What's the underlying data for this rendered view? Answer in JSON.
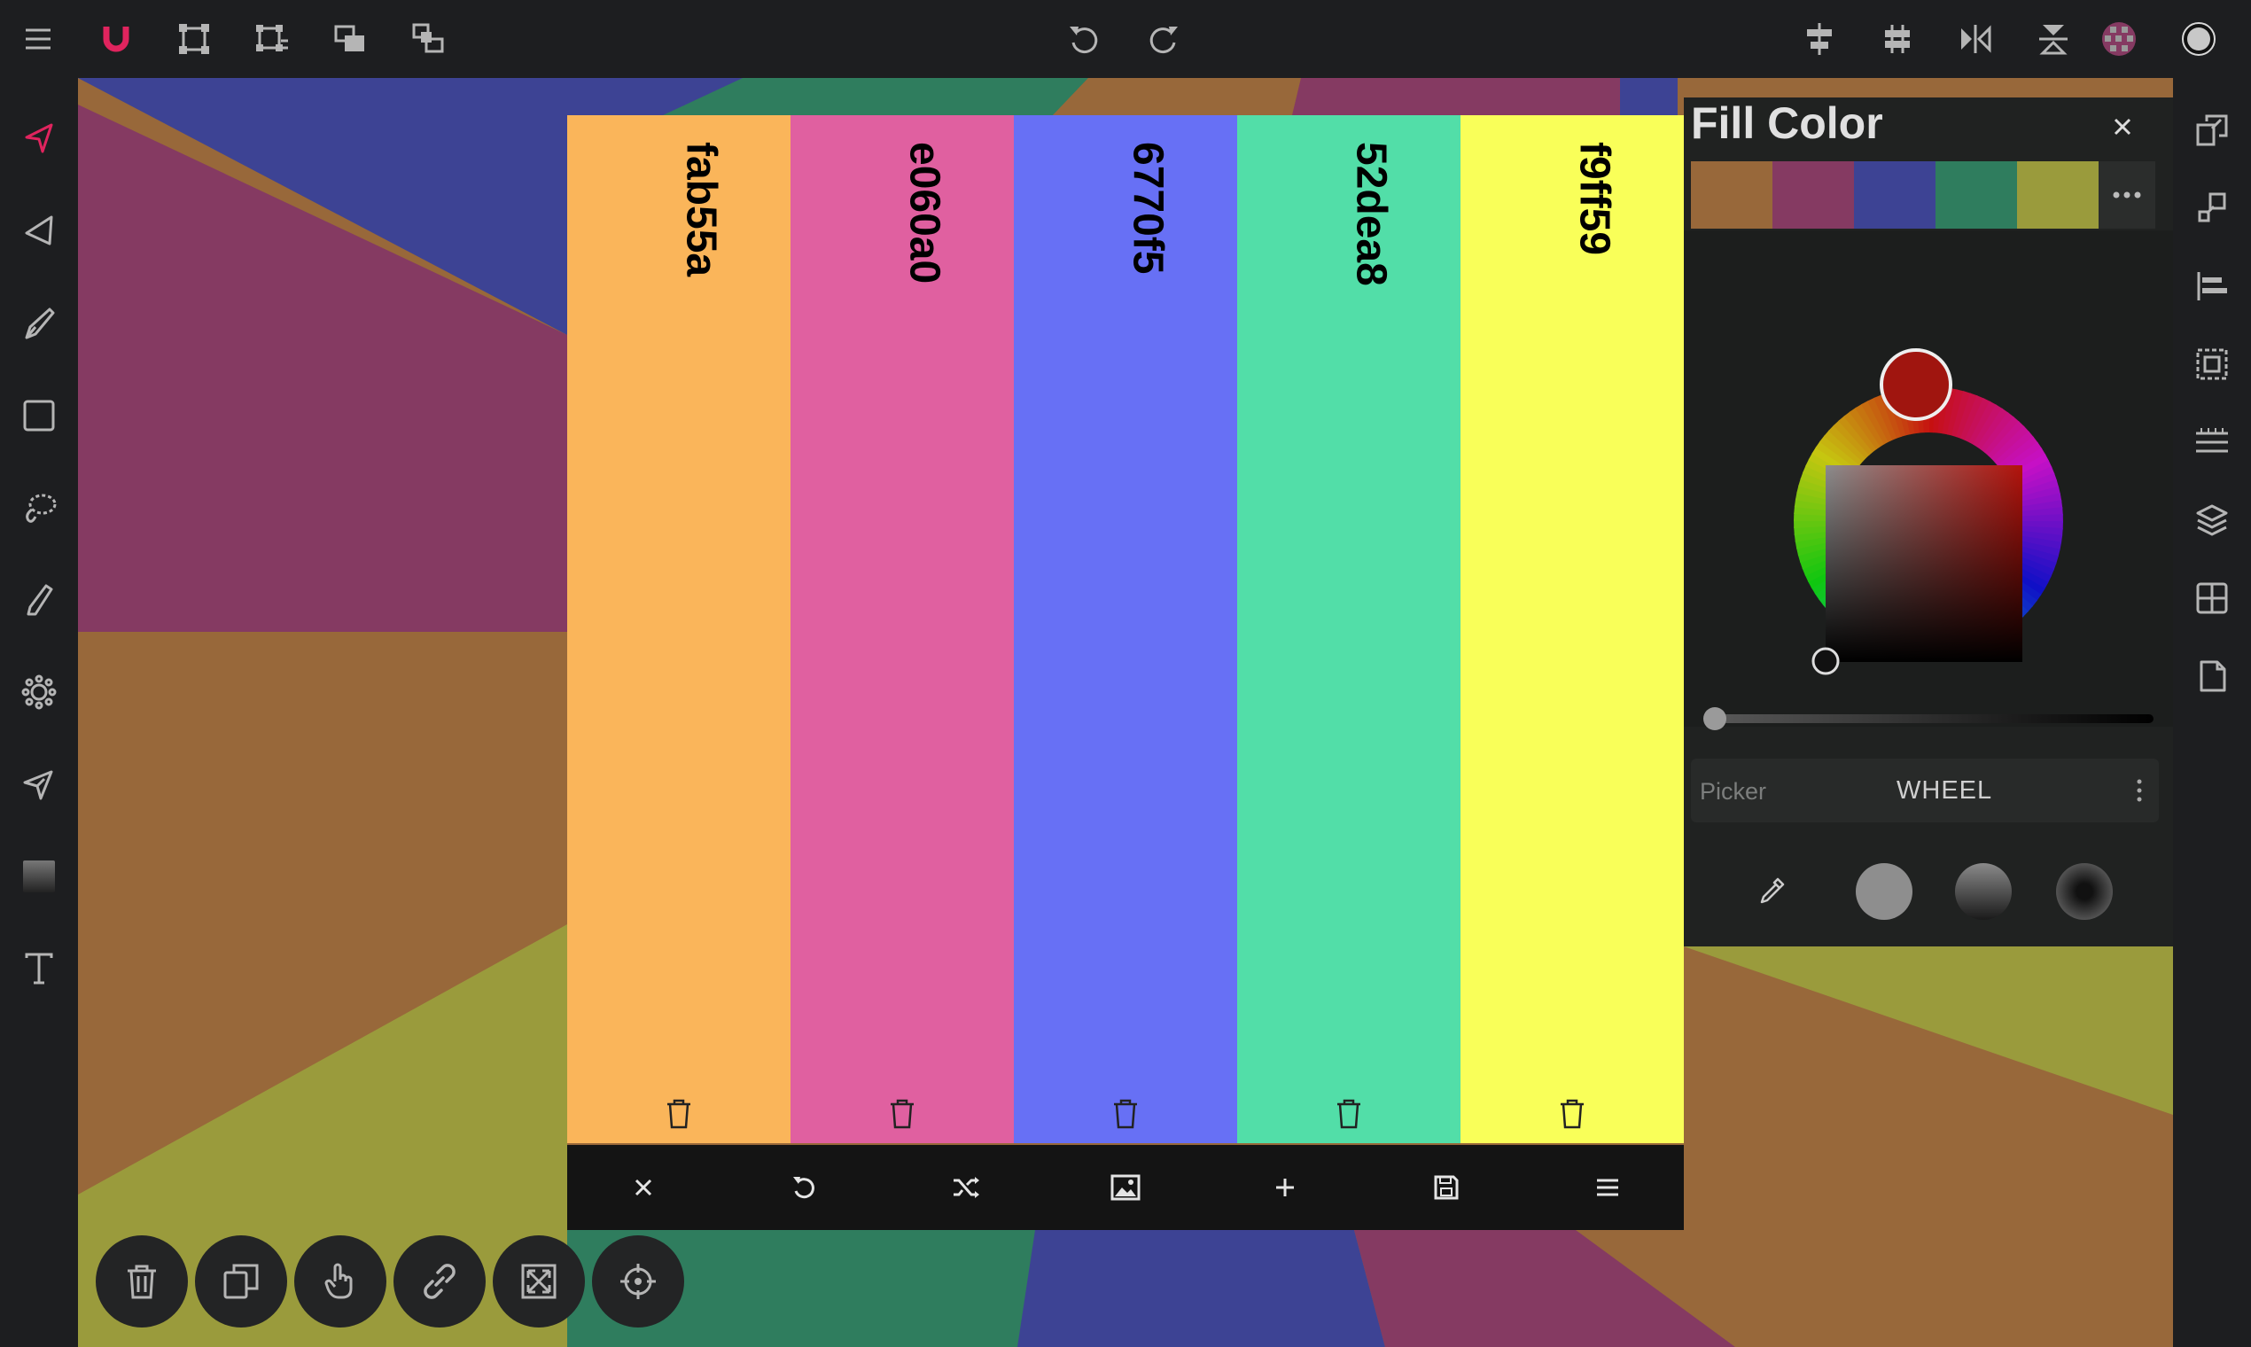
{
  "colors": {
    "bar_bg": "#1d1e20",
    "icon": "#b5b5b5",
    "accent": "#e0245e",
    "canvas_bg": [
      "#3d4394",
      "#853a62",
      "#98683a",
      "#9a9b3c",
      "#2f7d5e"
    ]
  },
  "top_toolbar": {
    "left_icons": [
      "menu-icon",
      "magnet-icon",
      "transform-icon",
      "resize-icon",
      "arrange-icon",
      "group-icon"
    ],
    "center_icons": [
      "undo-icon",
      "redo-icon"
    ],
    "right_icons": [
      "align-center-icon",
      "distribute-icon",
      "flip-horizontal-icon",
      "flip-vertical-icon",
      "fill-swatch",
      "stroke-swatch"
    ]
  },
  "left_tools": [
    "select-icon",
    "node-icon",
    "pen-icon",
    "rectangle-icon",
    "lasso-icon",
    "pencil-icon",
    "gear-icon",
    "path-icon",
    "gradient-icon",
    "text-icon"
  ],
  "right_tools": [
    "copy-style-icon",
    "shapes-icon",
    "align-icon",
    "frame-icon",
    "grid-lines-icon",
    "layers-icon",
    "table-icon",
    "page-icon"
  ],
  "palette": {
    "swatches": [
      {
        "hex": "fab55a",
        "color": "#fab55a"
      },
      {
        "hex": "e060a0",
        "color": "#e060a0"
      },
      {
        "hex": "6770f5",
        "color": "#6770f5"
      },
      {
        "hex": "52dea8",
        "color": "#52dea8"
      },
      {
        "hex": "f9ff59",
        "color": "#f9ff59"
      }
    ],
    "toolbar_icons": [
      "close-icon",
      "undo-icon",
      "shuffle-icon",
      "image-icon",
      "plus-icon",
      "save-icon",
      "menu-icon"
    ]
  },
  "fill_panel": {
    "title": "Fill Color",
    "recent_colors": [
      "#98683a",
      "#853a62",
      "#3d4394",
      "#2f7d5e",
      "#9a9b3c"
    ],
    "selected_hue_color": "#a0150f",
    "picker_label": "Picker",
    "picker_mode": "WHEEL",
    "opacity_value": 0
  },
  "bottom_actions": [
    "trash-icon",
    "duplicate-icon",
    "touch-icon",
    "link-icon",
    "fit-icon",
    "target-icon"
  ]
}
